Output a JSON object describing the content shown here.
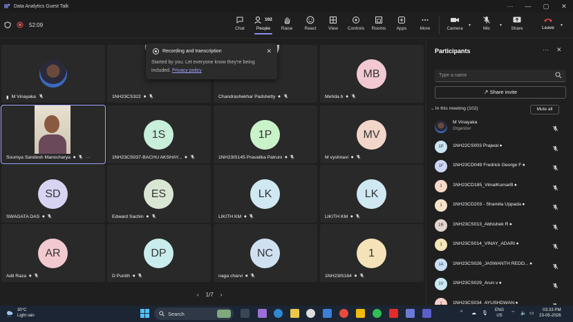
{
  "window": {
    "title": "Data Analytics Guest Talk",
    "minimize": "—",
    "maximize": "▢",
    "close": "✕",
    "more": "···"
  },
  "toolbar": {
    "timer": "52:09",
    "items": [
      {
        "label": "Chat"
      },
      {
        "label": "People",
        "count": "102"
      },
      {
        "label": "Raise"
      },
      {
        "label": "React"
      },
      {
        "label": "View"
      },
      {
        "label": "Controls"
      },
      {
        "label": "Rooms"
      },
      {
        "label": "Apps"
      },
      {
        "label": "More"
      },
      {
        "label": "Camera"
      },
      {
        "label": "Mic"
      },
      {
        "label": "Share"
      },
      {
        "label": "Leave"
      }
    ]
  },
  "popup": {
    "title": "Recording and transcription",
    "body": "Started by you. Let everyone know they're being included.",
    "link": "Privacy policy"
  },
  "tiles": [
    {
      "name": "M Vinayaka",
      "initials": "",
      "color": "#292929",
      "signal": true
    },
    {
      "name": "1NH23CS322",
      "initials": "",
      "color": "#292929"
    },
    {
      "name": "Chandrashekhar Padshetty",
      "initials": "",
      "color": "#292929"
    },
    {
      "name": "Mehda b",
      "initials": "MB",
      "color": "#f2c9d2"
    },
    {
      "name": "Soumya Sandesh Manocharya",
      "initials": "",
      "color": "#292929",
      "selected": true
    },
    {
      "name": "1NH23CS037-BACHU AKSHAY...",
      "initials": "1S",
      "color": "#c7efd9"
    },
    {
      "name": "1NH23IS145 Pravalika Patruni",
      "initials": "1P",
      "color": "#c9f2c9"
    },
    {
      "name": "M vyshnavi",
      "initials": "MV",
      "color": "#f2d6c9"
    },
    {
      "name": "SWAGATA DAS",
      "initials": "SD",
      "color": "#d7d3f2"
    },
    {
      "name": "Edward Sachin",
      "initials": "ES",
      "color": "#d9e6d3"
    },
    {
      "name": "LIKITH KM",
      "initials": "LK",
      "color": "#cfe8f2"
    },
    {
      "name": "LIKITH KM",
      "initials": "LK",
      "color": "#cfe8f2"
    },
    {
      "name": "Adil Raza",
      "initials": "AR",
      "color": "#f2c9cf"
    },
    {
      "name": "D Punith",
      "initials": "DP",
      "color": "#c9ecec"
    },
    {
      "name": "naga charvi",
      "initials": "NC",
      "color": "#cfe0f2"
    },
    {
      "name": "1NH23IS164",
      "initials": "1",
      "color": "#f5e2b8"
    }
  ],
  "pager": {
    "prev": "‹",
    "page": "1/7",
    "next": "›"
  },
  "panel": {
    "title": "Participants",
    "more": "···",
    "close": "✕",
    "search_placeholder": "Type a name",
    "share_invite": "Share invite",
    "in_meeting": "In this meeting (102)",
    "mute_all": "Mute all",
    "participants": [
      {
        "name": "M Vinayaka",
        "role": "Organizer",
        "initials": "",
        "color": "#444"
      },
      {
        "name": "1NH22CS003 Prajwal",
        "initials": "1P",
        "color": "#c9e6f2"
      },
      {
        "name": "1NH23CD049 Fredrick George F",
        "initials": "1F",
        "color": "#cdd6f5"
      },
      {
        "name": "1NH23CD185_VimalKumarB",
        "initials": "1",
        "color": "#f5d9c9"
      },
      {
        "name": "1NH23CD203 - Shamita Uppada",
        "initials": "1",
        "color": "#f5e2c9"
      },
      {
        "name": "1NH23CS013_Abhishek R",
        "initials": "1R",
        "color": "#e3d6d0"
      },
      {
        "name": "1NH23CS014_VINAY_ADARI",
        "initials": "1",
        "color": "#f5e6b8"
      },
      {
        "name": "1NH23CS026_JASWANTH REDD...",
        "initials": "1A",
        "color": "#c9dff5"
      },
      {
        "name": "1NH23CS029_Arun v",
        "initials": "1V",
        "color": "#c9eaf5"
      },
      {
        "name": "1NH23CS034_AYUSHDWAN",
        "initials": "1",
        "color": "#f5d0c9"
      }
    ]
  },
  "taskbar": {
    "temp": "30°C",
    "weather": "Light rain",
    "search": "Search",
    "lang1": "ENG",
    "lang2": "US",
    "time": "03:33 PM",
    "date": "23-05-2026"
  }
}
